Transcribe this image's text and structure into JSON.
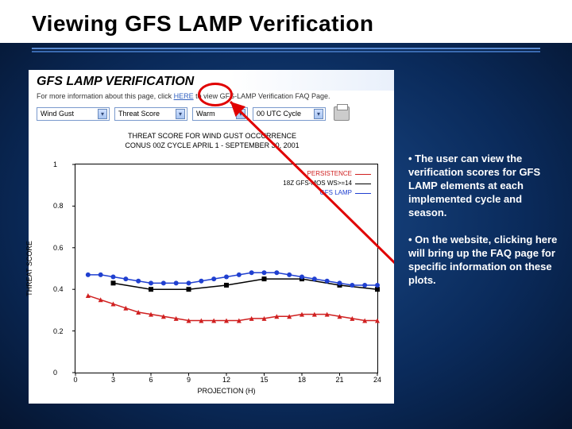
{
  "slide_title": "Viewing GFS LAMP Verification",
  "panel": {
    "heading": "GFS LAMP VERIFICATION",
    "subtext_pre": "For more information about this page, click ",
    "subtext_link": "HERE",
    "subtext_post": " to view GFS-LAMP Verification FAQ Page.",
    "selects": [
      {
        "value": "Wind Gust",
        "w": 92
      },
      {
        "value": "Threat Score",
        "w": 92
      },
      {
        "value": "Warm",
        "w": 70
      },
      {
        "value": "00 UTC Cycle",
        "w": 92
      }
    ]
  },
  "chart_data": {
    "type": "line",
    "title": "THREAT SCORE FOR WIND GUST OCCURRENCE",
    "subtitle": "CONUS  00Z CYCLE   APRIL 1 - SEPTEMBER 30, 2001",
    "xlabel": "PROJECTION (H)",
    "ylabel": "THREAT SCORE",
    "xlim": [
      0,
      24
    ],
    "ylim": [
      0,
      1
    ],
    "xticks": [
      0,
      3,
      6,
      9,
      12,
      15,
      18,
      21,
      24
    ],
    "yticks": [
      0,
      0.2,
      0.4,
      0.6,
      0.8,
      1
    ],
    "x": [
      1,
      2,
      3,
      4,
      5,
      6,
      7,
      8,
      9,
      10,
      11,
      12,
      13,
      14,
      15,
      16,
      17,
      18,
      19,
      20,
      21,
      22,
      23,
      24
    ],
    "series": [
      {
        "name": "PERSISTENCE",
        "color": "#d02020",
        "marker": "triangle",
        "values": [
          0.37,
          0.35,
          0.33,
          0.31,
          0.29,
          0.28,
          0.27,
          0.26,
          0.25,
          0.25,
          0.25,
          0.25,
          0.25,
          0.26,
          0.26,
          0.27,
          0.27,
          0.28,
          0.28,
          0.28,
          0.27,
          0.26,
          0.25,
          0.25
        ]
      },
      {
        "name": "18Z GFS-MOS WS>=14",
        "color": "#000000",
        "marker": "square",
        "values": [
          null,
          null,
          0.43,
          null,
          null,
          0.4,
          null,
          null,
          0.4,
          null,
          null,
          0.42,
          null,
          null,
          0.45,
          null,
          null,
          0.45,
          null,
          null,
          0.42,
          null,
          null,
          0.4
        ]
      },
      {
        "name": "GFS LAMP",
        "color": "#2040d0",
        "marker": "circle",
        "values": [
          0.47,
          0.47,
          0.46,
          0.45,
          0.44,
          0.43,
          0.43,
          0.43,
          0.43,
          0.44,
          0.45,
          0.46,
          0.47,
          0.48,
          0.48,
          0.48,
          0.47,
          0.46,
          0.45,
          0.44,
          0.43,
          0.42,
          0.42,
          0.42
        ]
      }
    ]
  },
  "bullets": [
    "• The user can view the verification scores for GFS LAMP elements at each implemented cycle and season.",
    "• On the website, clicking here will bring up the FAQ page for specific information on these plots."
  ]
}
